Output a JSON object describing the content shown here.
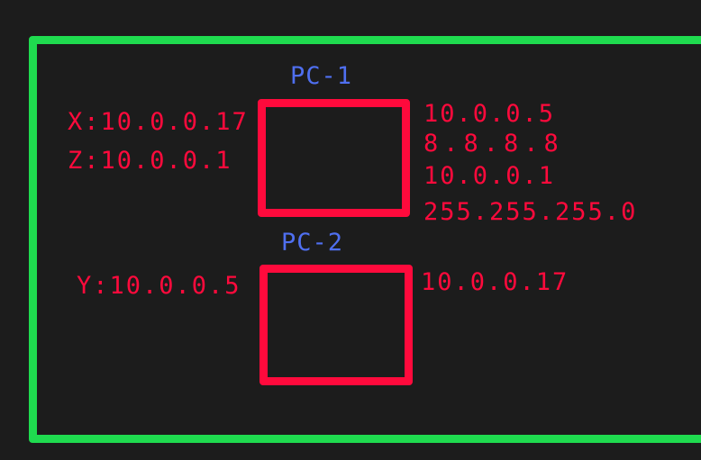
{
  "colors": {
    "background": "#1c1c1c",
    "frame": "#1fdb4f",
    "box": "#ff0a3c",
    "text_red": "#ff0a3c",
    "text_blue": "#4f6ff0"
  },
  "pc1": {
    "title": "PC-1",
    "left_labels": [
      "X:10.0.0.17",
      "Z:10.0.0.1"
    ],
    "right_labels": [
      "10.0.0.5",
      "8.8.8.8",
      "10.0.0.1",
      "255.255.255.0"
    ]
  },
  "pc2": {
    "title": "PC-2",
    "left_labels": [
      "Y:10.0.0.5"
    ],
    "right_labels": [
      "10.0.0.17"
    ]
  }
}
